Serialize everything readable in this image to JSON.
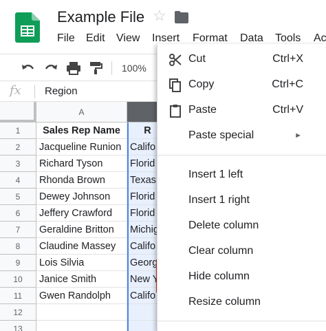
{
  "window": {
    "title": "Example File"
  },
  "menubar": [
    "File",
    "Edit",
    "View",
    "Insert",
    "Format",
    "Data",
    "Tools",
    "Ac"
  ],
  "toolbar": {
    "zoom": "100%"
  },
  "formula_bar": {
    "fx": "fx",
    "value": "Region"
  },
  "columns": {
    "a": "A"
  },
  "rows": [
    {
      "num": "1",
      "name": "Sales Rep Name",
      "region": "R"
    },
    {
      "num": "2",
      "name": "Jacqueline Runion",
      "region": "Califo"
    },
    {
      "num": "3",
      "name": "Richard Tyson",
      "region": "Florid"
    },
    {
      "num": "4",
      "name": "Rhonda Brown",
      "region": "Texas"
    },
    {
      "num": "5",
      "name": "Dewey Johnson",
      "region": "Florid"
    },
    {
      "num": "6",
      "name": "Jeffery Crawford",
      "region": "Florid"
    },
    {
      "num": "7",
      "name": "Geraldine Britton",
      "region": "Michig"
    },
    {
      "num": "8",
      "name": "Claudine Massey",
      "region": "Califo"
    },
    {
      "num": "9",
      "name": "Lois Silvia",
      "region": "Georg"
    },
    {
      "num": "10",
      "name": "Janice Smith",
      "region": "New Y"
    },
    {
      "num": "11",
      "name": "Gwen Randolph",
      "region": "Califo"
    },
    {
      "num": "12",
      "name": "",
      "region": ""
    },
    {
      "num": "13",
      "name": "",
      "region": ""
    }
  ],
  "context_menu": {
    "cut": {
      "label": "Cut",
      "shortcut": "Ctrl+X"
    },
    "copy": {
      "label": "Copy",
      "shortcut": "Ctrl+C"
    },
    "paste": {
      "label": "Paste",
      "shortcut": "Ctrl+V"
    },
    "paste_special": {
      "label": "Paste special",
      "arrow": "►"
    },
    "insert_left": {
      "label": "Insert 1 left"
    },
    "insert_right": {
      "label": "Insert 1 right"
    },
    "delete_column": {
      "label": "Delete column"
    },
    "clear_column": {
      "label": "Clear column"
    },
    "hide_column": {
      "label": "Hide column"
    },
    "resize_column": {
      "label": "Resize column"
    }
  },
  "colors": {
    "sheets_green": "#0f9d58",
    "selection_blue": "#4a86e8",
    "highlight_red": "#d9312e"
  }
}
